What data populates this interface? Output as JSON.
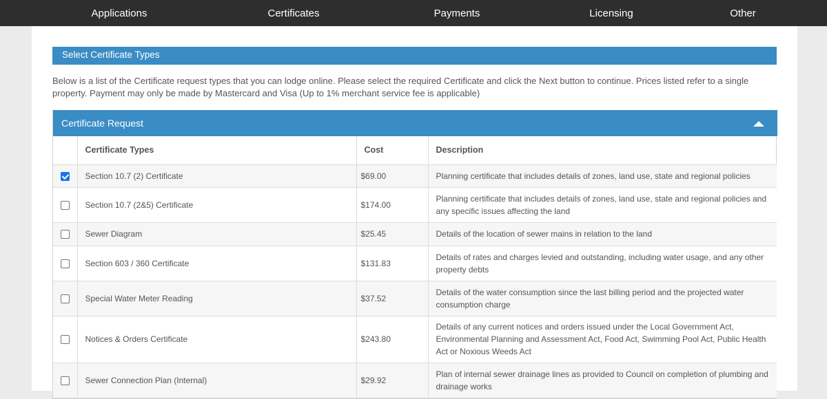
{
  "nav": {
    "items": [
      {
        "label": "Applications"
      },
      {
        "label": "Certificates"
      },
      {
        "label": "Payments"
      },
      {
        "label": "Licensing"
      },
      {
        "label": "Other"
      }
    ]
  },
  "section": {
    "title": "Select Certificate Types",
    "intro_line1": "Below is a list of the Certificate request types that you can lodge online. Please select the required Certificate and click the Next button to continue. Prices listed refer to a single",
    "intro_line2": "property. Payment may only be made by Mastercard and Visa (Up to 1% merchant service fee is applicable)"
  },
  "panel": {
    "title": "Certificate Request",
    "columns": {
      "type": "Certificate Types",
      "cost": "Cost",
      "description": "Description"
    },
    "rows": [
      {
        "checked": true,
        "type": "Section 10.7 (2) Certificate",
        "cost": "$69.00",
        "description": "Planning certificate that includes details of zones, land use, state and regional policies"
      },
      {
        "checked": false,
        "type": "Section 10.7 (2&5) Certificate",
        "cost": "$174.00",
        "description": "Planning certificate that includes details of zones, land use, state and regional policies and any specific issues affecting the land"
      },
      {
        "checked": false,
        "type": "Sewer Diagram",
        "cost": "$25.45",
        "description": "Details of the location of sewer mains in relation to the land"
      },
      {
        "checked": false,
        "type": "Section 603 / 360 Certificate",
        "cost": "$131.83",
        "description": "Details of rates and charges levied and outstanding, including water usage, and any other property debts"
      },
      {
        "checked": false,
        "type": "Special Water Meter Reading",
        "cost": "$37.52",
        "description": "Details of the water consumption since the last billing period and the projected water consumption charge"
      },
      {
        "checked": false,
        "type": "Notices & Orders Certificate",
        "cost": "$243.80",
        "description": "Details of any current notices and orders issued under the Local Government Act, Environmental Planning and Assessment Act, Food Act, Swimming Pool Act, Public Health Act or Noxious Weeds Act"
      },
      {
        "checked": false,
        "type": "Sewer Connection Plan (Internal)",
        "cost": "$29.92",
        "description": "Plan of internal sewer drainage lines as provided to Council on completion of plumbing and drainage works"
      }
    ]
  }
}
